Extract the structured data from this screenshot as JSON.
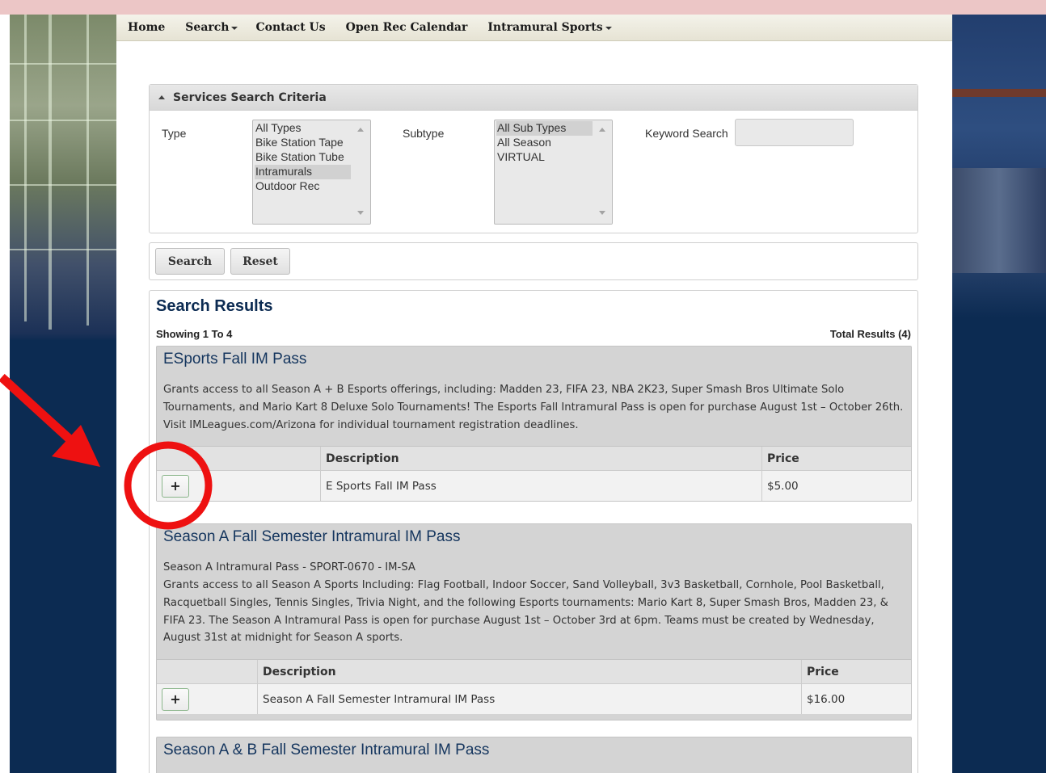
{
  "nav": {
    "items": [
      "Home",
      "Search",
      "Contact Us",
      "Open Rec Calendar",
      "Intramural Sports"
    ]
  },
  "criteria": {
    "header": "Services Search Criteria",
    "type_label": "Type",
    "type_options": [
      "All Types",
      "Bike Station Tape",
      "Bike Station Tube",
      "Intramurals",
      "Outdoor Rec"
    ],
    "type_selected": "Intramurals",
    "subtype_label": "Subtype",
    "subtype_options": [
      "All Sub Types",
      "All Season",
      "VIRTUAL"
    ],
    "subtype_selected": "All Sub Types",
    "keyword_label": "Keyword Search",
    "keyword_value": ""
  },
  "buttons": {
    "search": "Search",
    "reset": "Reset"
  },
  "results": {
    "title": "Search Results",
    "showing": "Showing 1 To 4",
    "total": "Total Results (4)",
    "items": [
      {
        "title": "ESports Fall IM Pass",
        "description": "Grants access to all Season A + B Esports offerings, including: Madden 23, FIFA 23, NBA 2K23, Super Smash Bros Ultimate Solo Tournaments, and Mario Kart 8 Deluxe Solo Tournaments! The Esports Fall Intramural Pass is open for purchase August 1st – October 26th. Visit IMLeagues.com/Arizona for individual tournament registration deadlines.",
        "col_description": "Description",
        "col_price": "Price",
        "row_description": "E Sports Fall IM Pass",
        "row_price": "$5.00"
      },
      {
        "title": "Season A Fall Semester Intramural IM Pass",
        "subtitle": "Season A Intramural Pass - SPORT-0670 - IM-SA",
        "description": "Grants access to all Season A Sports Including: Flag Football, Indoor Soccer, Sand Volleyball, 3v3 Basketball, Cornhole, Pool Basketball, Racquetball Singles, Tennis Singles, Trivia Night, and the following Esports tournaments: Mario Kart 8, Super Smash Bros, Madden 23, & FIFA 23. The Season A Intramural Pass is open for purchase August 1st – October 3rd at 6pm. Teams must be created by Wednesday, August 31st at midnight for Season A sports.",
        "col_description": "Description",
        "col_price": "Price",
        "row_description": "Season A Fall Semester Intramural IM Pass",
        "row_price": "$16.00"
      },
      {
        "title": "Season A & B Fall Semester Intramural IM Pass"
      }
    ],
    "add_symbol": "+"
  },
  "annotation": {
    "color": "#ee1111"
  }
}
